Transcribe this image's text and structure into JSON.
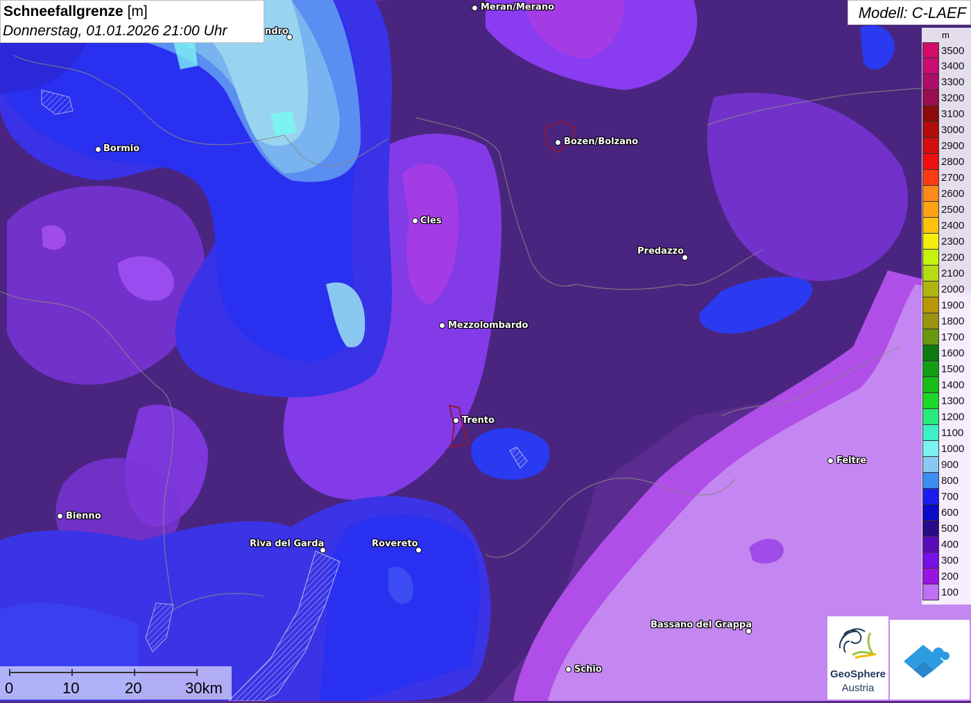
{
  "header": {
    "title_bold": "Schneefallgrenze",
    "title_unit": "[m]",
    "subtitle": "Donnerstag, 01.01.2026 21:00 Uhr",
    "model": "Modell: C-LAEF"
  },
  "legend": {
    "unit": "m",
    "items": [
      {
        "label": "3500",
        "color": "#d10c6a"
      },
      {
        "label": "3400",
        "color": "#c90d72"
      },
      {
        "label": "3300",
        "color": "#b00c6a"
      },
      {
        "label": "3200",
        "color": "#9a0d4e"
      },
      {
        "label": "3100",
        "color": "#8b0a0a"
      },
      {
        "label": "3000",
        "color": "#b30c0c"
      },
      {
        "label": "2900",
        "color": "#d40e0e"
      },
      {
        "label": "2800",
        "color": "#ee1010"
      },
      {
        "label": "2700",
        "color": "#ff3a14"
      },
      {
        "label": "2600",
        "color": "#ff8a18"
      },
      {
        "label": "2500",
        "color": "#ffa214"
      },
      {
        "label": "2400",
        "color": "#ffc20c"
      },
      {
        "label": "2300",
        "color": "#f4ee0a"
      },
      {
        "label": "2200",
        "color": "#c6f20c"
      },
      {
        "label": "2100",
        "color": "#b8dc12"
      },
      {
        "label": "2000",
        "color": "#b0b40e"
      },
      {
        "label": "1900",
        "color": "#b89808"
      },
      {
        "label": "1800",
        "color": "#9a9410"
      },
      {
        "label": "1700",
        "color": "#6a980e"
      },
      {
        "label": "1600",
        "color": "#0c7a10"
      },
      {
        "label": "1500",
        "color": "#129e14"
      },
      {
        "label": "1400",
        "color": "#18bc18"
      },
      {
        "label": "1300",
        "color": "#1cd82a"
      },
      {
        "label": "1200",
        "color": "#28ea7a"
      },
      {
        "label": "1100",
        "color": "#3cf0c8"
      },
      {
        "label": "1000",
        "color": "#7cf2f2"
      },
      {
        "label": "900",
        "color": "#88c8f2"
      },
      {
        "label": "800",
        "color": "#3c8ef0"
      },
      {
        "label": "700",
        "color": "#1c1cf0"
      },
      {
        "label": "600",
        "color": "#0a0ac8"
      },
      {
        "label": "500",
        "color": "#2a0a88"
      },
      {
        "label": "400",
        "color": "#5a0ab8"
      },
      {
        "label": "300",
        "color": "#7810e8"
      },
      {
        "label": "200",
        "color": "#9a14e0"
      },
      {
        "label": "100",
        "color": "#c070f8"
      }
    ]
  },
  "cities": [
    {
      "name": "Meran/Merano",
      "id": "meran"
    },
    {
      "name": "ndro",
      "id": "sondrio"
    },
    {
      "name": "Bormio",
      "id": "bormio"
    },
    {
      "name": "Bozen/Bolzano",
      "id": "bozen"
    },
    {
      "name": "Cles",
      "id": "cles"
    },
    {
      "name": "Predazzo",
      "id": "predazzo"
    },
    {
      "name": "Mezzolombardo",
      "id": "mezzolombardo"
    },
    {
      "name": "Trento",
      "id": "trento"
    },
    {
      "name": "Feltre",
      "id": "feltre"
    },
    {
      "name": "Bienno",
      "id": "bienno"
    },
    {
      "name": "Riva del Garda",
      "id": "riva"
    },
    {
      "name": "Rovereto",
      "id": "rovereto"
    },
    {
      "name": "Bassano del Grappa",
      "id": "bassano"
    },
    {
      "name": "Schio",
      "id": "schio"
    }
  ],
  "scalebar": {
    "labels": [
      "0",
      "10",
      "20",
      "30km"
    ]
  },
  "logos": {
    "geosphere_name": "GeoSphere",
    "geosphere_sub": "Austria"
  }
}
